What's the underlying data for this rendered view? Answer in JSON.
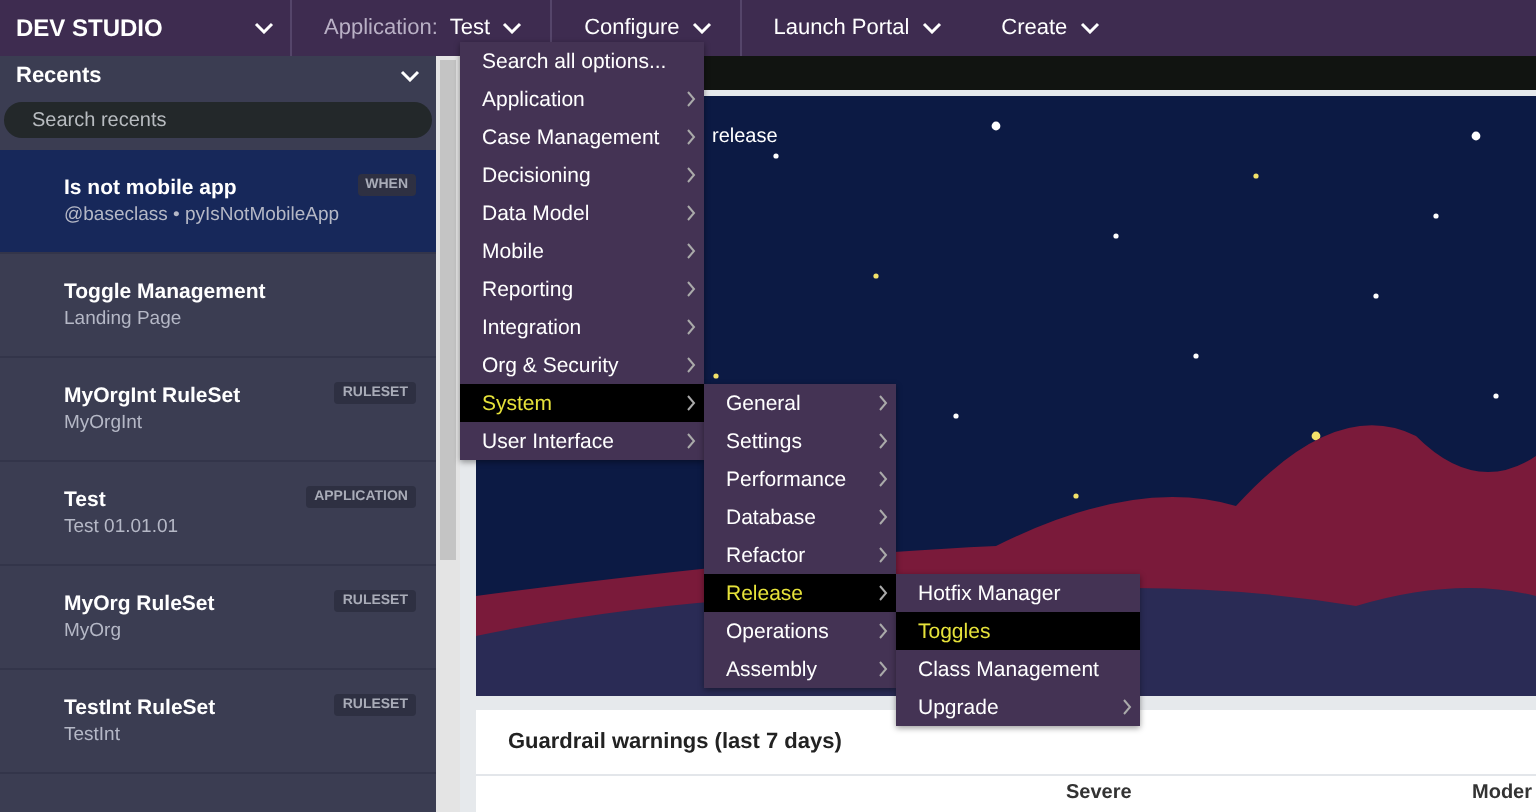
{
  "topbar": {
    "brand": "DEV STUDIO",
    "nav": [
      {
        "label": "Application:",
        "value": "Test"
      },
      {
        "label": "Configure"
      },
      {
        "label": "Launch Portal"
      },
      {
        "label": "Create"
      }
    ]
  },
  "sidebar": {
    "title": "Recents",
    "search": {
      "placeholder": "Search recents"
    },
    "items": [
      {
        "title": "Is not mobile app",
        "subtitle": "@baseclass • pyIsNotMobileApp",
        "badge": "WHEN",
        "selected": true
      },
      {
        "title": "Toggle Management",
        "subtitle": "Landing Page",
        "selected": false
      },
      {
        "title": "MyOrgInt RuleSet",
        "subtitle": "MyOrgInt",
        "badge": "RULESET",
        "selected": false
      },
      {
        "title": "Test",
        "subtitle": "Test 01.01.01",
        "badge": "APPLICATION",
        "selected": false
      },
      {
        "title": "MyOrg RuleSet",
        "subtitle": "MyOrg",
        "badge": "RULESET",
        "selected": false
      },
      {
        "title": "TestInt RuleSet",
        "subtitle": "TestInt",
        "badge": "RULESET",
        "selected": false
      }
    ]
  },
  "main": {
    "banner_text": "release",
    "card": {
      "title": "Guardrail warnings (last 7 days)",
      "columns": [
        "Severe",
        "Moder"
      ]
    }
  },
  "menu": {
    "items": [
      {
        "label": "Search all options...",
        "submenu": false,
        "selected": false
      },
      {
        "label": "Application",
        "submenu": true,
        "selected": false
      },
      {
        "label": "Case Management",
        "submenu": true,
        "selected": false
      },
      {
        "label": "Decisioning",
        "submenu": true,
        "selected": false
      },
      {
        "label": "Data Model",
        "submenu": true,
        "selected": false
      },
      {
        "label": "Mobile",
        "submenu": true,
        "selected": false
      },
      {
        "label": "Reporting",
        "submenu": true,
        "selected": false
      },
      {
        "label": "Integration",
        "submenu": true,
        "selected": false
      },
      {
        "label": "Org & Security",
        "submenu": true,
        "selected": false
      },
      {
        "label": "System",
        "submenu": true,
        "selected": true,
        "children": [
          {
            "label": "General",
            "submenu": true,
            "selected": false
          },
          {
            "label": "Settings",
            "submenu": true,
            "selected": false
          },
          {
            "label": "Performance",
            "submenu": true,
            "selected": false
          },
          {
            "label": "Database",
            "submenu": true,
            "selected": false
          },
          {
            "label": "Refactor",
            "submenu": true,
            "selected": false
          },
          {
            "label": "Release",
            "submenu": true,
            "selected": true,
            "children": [
              {
                "label": "Hotfix Manager",
                "submenu": false,
                "selected": false
              },
              {
                "label": "Toggles",
                "submenu": false,
                "selected": true
              },
              {
                "label": "Class Management",
                "submenu": false,
                "selected": false
              },
              {
                "label": "Upgrade",
                "submenu": true,
                "selected": false
              }
            ]
          },
          {
            "label": "Operations",
            "submenu": true,
            "selected": false
          },
          {
            "label": "Assembly",
            "submenu": true,
            "selected": false
          }
        ]
      },
      {
        "label": "User Interface",
        "submenu": true,
        "selected": false
      }
    ]
  }
}
